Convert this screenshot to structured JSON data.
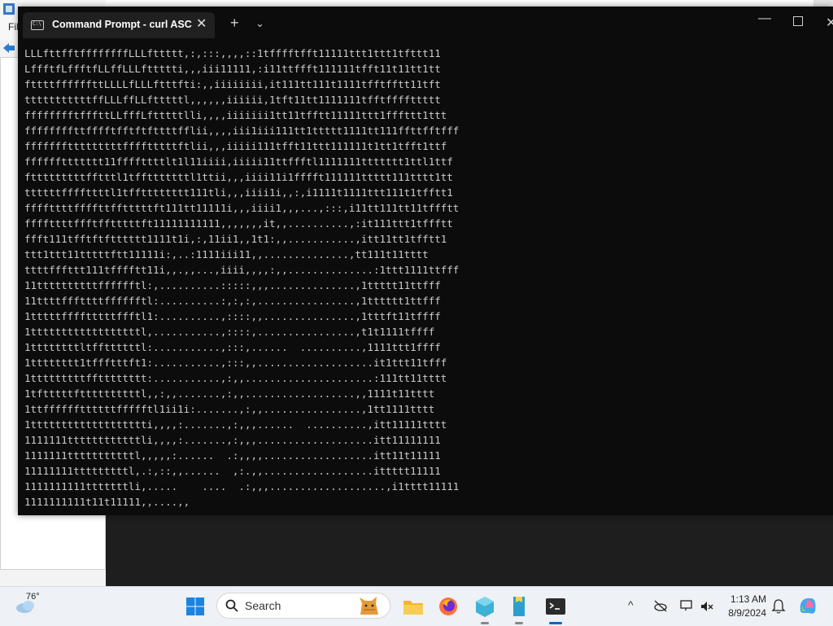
{
  "background_app": {
    "menu_label": "Fil"
  },
  "terminal": {
    "tab_title": "Command Prompt - curl  ASC",
    "buttons": {
      "close_tab": "✕",
      "new_tab": "+",
      "dropdown": "⌄",
      "minimize": "—",
      "close": "✕"
    },
    "output_lines": [
      "LLLfttfftffffffffLLLfttttt,:,:::,,,,::1tfffftfft11111ttt1ttt1tfttt11",
      "LffftfLffftfLLffLLLfttttti,,,iii11111,:i11ttffft111111tfft11t11tt1tt",
      "fttttffffffttLLLLfLLLftttfti:,,iiiiiiii,it111tt111t1111tfftfftt11tft",
      "tttttttttttffLLLffLLftttttl,,,,,,iiiiii,1tft11tt1111111tfftffffttttt",
      "fffffffftfffttLLfffLftttttlli,,,,iiiiiii1tt11tfftt11111ttt1fffttt1ttt",
      "ffffffffttfffftfftftfttttfflii,,,,iii1iii111tt1ttttt1111tt111ffttfftfff",
      "ffffffftttttttttfffftttttftlii,,,iiiii111tfft11ttt111111t1tt1tfft1ttf",
      "ffffffttttttt11ffffttttlt1l11iiii,iiiii11ttffftl1111111ttttttt1ttl1ttf",
      "ftttttttttfftttl1tfftttttttl1ttii,,,iiii11i1fffft111111ttttt111tttt1tt",
      "ttttttffffttttl1tfftttttttt111tli,,,iiii1i,,:,i1111t1111ttt111t1tfftt1",
      "ffffttttffffttfftttttft111tt11111i,,,iiii1,,,...,:::,i11tt111tt11tffftt",
      "ffffttttffftfftttttft11111111111,,,,,,,it,,..........,:it111ttt1tffftt",
      "ffft111tfftftftttttt1111t1i,:,11ii1,,1t1:,,...........,itt11tt1tfftt1",
      "ttt1ttt11tttttftt11111i:,..:1111iii11,,..............,tt111t11tttt",
      "ttttfffttt111tfffftt11i,,.,,...,iiii,,,,:,,..............:1ttt1111ttfff",
      "11ttttttttttfffffftl:,..........:::::,,,..............,1ttttt11ttfff",
      "11ttttfffttttfffffftl:..........:,:,:,................,1tttttt1ttfff",
      "1tttttfffftttttffftl1:..........,::::,,...............,1tttft11tffff",
      "1ttttttttttttttttttl,...........,::::,................,t1t1111tffff",
      "1ttttttttltffttttttl:...........,:::,......  ..........,1111ttt1ffff",
      "1tttttttt1tffftttft1:...........,:::,,...................it1ttt11tfff",
      "1tttttttttfftttttttt:...........,:,,.....................:111tt11tttt",
      "1tftttttfttttttttttl,,:,,.......,:,,..................,,1111t11tttt",
      "1ttffffffttttttffffftl1ii1i:.......,:,,................,1tt1111tttt",
      "1ttttttttttttttttttti,,,,:.......,:,,,......  ..........,itt11111tttt",
      "1111111ttttttttttttli,,,,:.......,:,,,...................itt11111111",
      "1111111tttttttttttl,,,,,:......  .:,,,,..................itt11t11111",
      "11111111tttttttttl,.:,::,,......  ,:.,,..................ittttt11111",
      "1111111111tttttttli,.....    ....  .:,,,...................,i1tttt11111",
      "1111111111t11t11111,,....,,"
    ]
  },
  "taskbar": {
    "weather_temp": "76°",
    "search_placeholder": "Search",
    "clock_time": "1:13 AM",
    "clock_date": "8/9/2024"
  }
}
